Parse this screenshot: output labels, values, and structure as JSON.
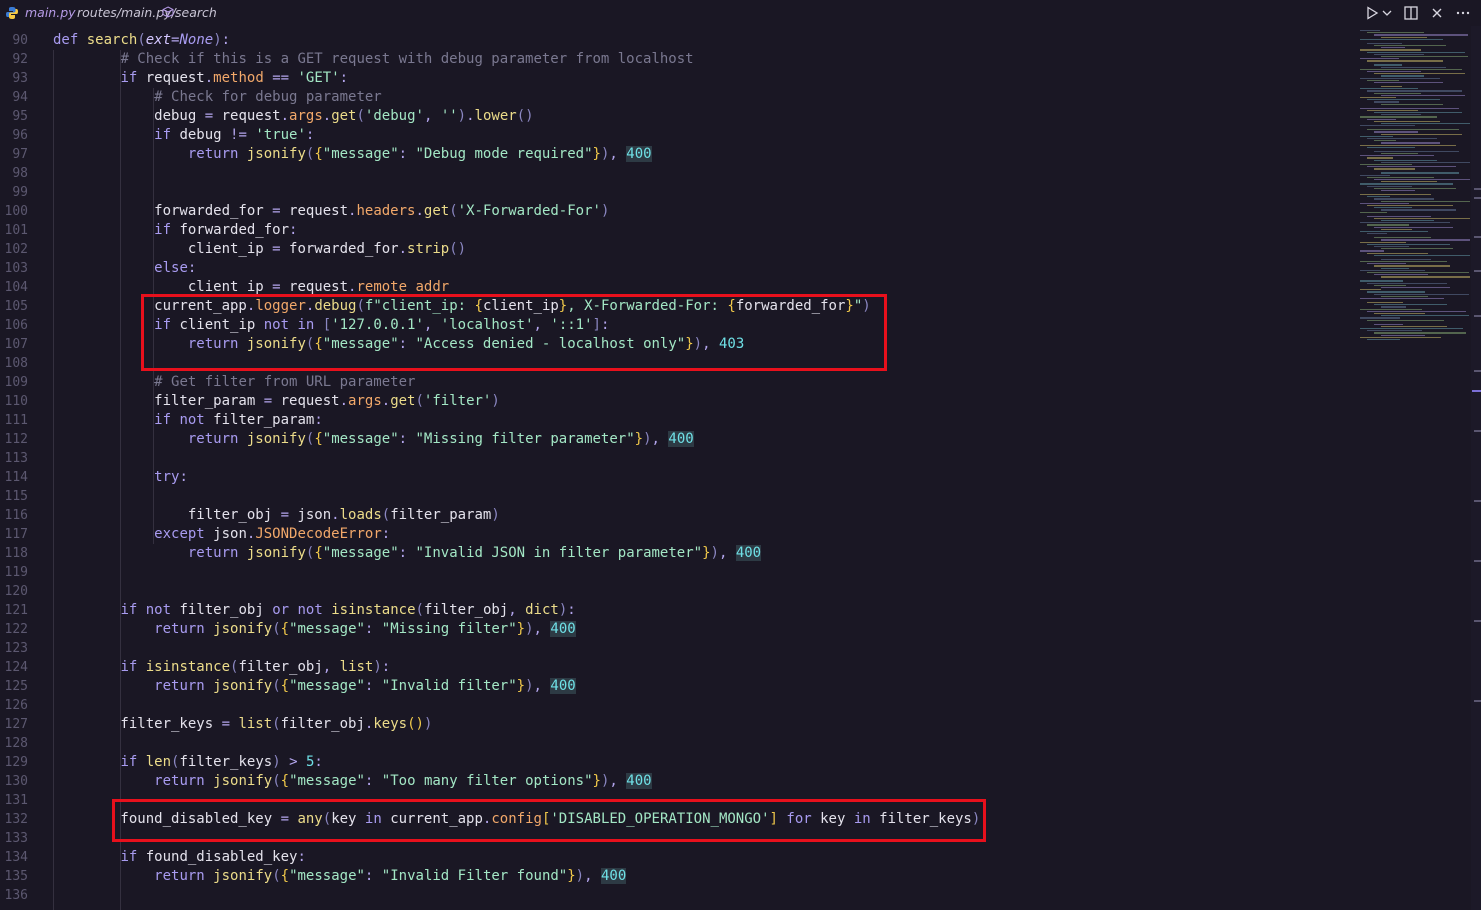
{
  "breadcrumb": {
    "file": "main.py",
    "path": "routes/main.py/",
    "symbol": "search",
    "icons": [
      "python-icon",
      "symbol-method-icon"
    ]
  },
  "toolbar": {
    "icons": [
      "run-icon",
      "dropdown-chevron-icon",
      "split-editor-icon",
      "close-icon",
      "more-actions-icon"
    ]
  },
  "editor": {
    "lines": [
      {
        "num": "90",
        "code": "def search(ext=None):"
      },
      {
        "num": "92",
        "code": "        # Check if this is a GET request with debug parameter from localhost"
      },
      {
        "num": "93",
        "code": "        if request.method == 'GET':"
      },
      {
        "num": "94",
        "code": "            # Check for debug parameter"
      },
      {
        "num": "95",
        "code": "            debug = request.args.get('debug', '').lower()"
      },
      {
        "num": "96",
        "code": "            if debug != 'true':"
      },
      {
        "num": "97",
        "code": "                return jsonify({\"message\": \"Debug mode required\"}), 400"
      },
      {
        "num": "98",
        "code": ""
      },
      {
        "num": "99",
        "code": ""
      },
      {
        "num": "100",
        "code": "            forwarded_for = request.headers.get('X-Forwarded-For')"
      },
      {
        "num": "101",
        "code": "            if forwarded_for:"
      },
      {
        "num": "102",
        "code": "                client_ip = forwarded_for.strip()"
      },
      {
        "num": "103",
        "code": "            else:"
      },
      {
        "num": "104",
        "code": "                client_ip = request.remote_addr"
      },
      {
        "num": "105",
        "code": "            current_app.logger.debug(f\"client_ip: {client_ip}, X-Forwarded-For: {forwarded_for}\")"
      },
      {
        "num": "106",
        "code": "            if client_ip not in ['127.0.0.1', 'localhost', '::1']:"
      },
      {
        "num": "107",
        "code": "                return jsonify({\"message\": \"Access denied - localhost only\"}), 403"
      },
      {
        "num": "108",
        "code": ""
      },
      {
        "num": "109",
        "code": "            # Get filter from URL parameter"
      },
      {
        "num": "110",
        "code": "            filter_param = request.args.get('filter')"
      },
      {
        "num": "111",
        "code": "            if not filter_param:"
      },
      {
        "num": "112",
        "code": "                return jsonify({\"message\": \"Missing filter parameter\"}), 400"
      },
      {
        "num": "113",
        "code": ""
      },
      {
        "num": "114",
        "code": "            try:"
      },
      {
        "num": "115",
        "code": ""
      },
      {
        "num": "116",
        "code": "                filter_obj = json.loads(filter_param)"
      },
      {
        "num": "117",
        "code": "            except json.JSONDecodeError:"
      },
      {
        "num": "118",
        "code": "                return jsonify({\"message\": \"Invalid JSON in filter parameter\"}), 400"
      },
      {
        "num": "119",
        "code": ""
      },
      {
        "num": "120",
        "code": ""
      },
      {
        "num": "121",
        "code": "        if not filter_obj or not isinstance(filter_obj, dict):"
      },
      {
        "num": "122",
        "code": "            return jsonify({\"message\": \"Missing filter\"}), 400"
      },
      {
        "num": "123",
        "code": ""
      },
      {
        "num": "124",
        "code": "        if isinstance(filter_obj, list):"
      },
      {
        "num": "125",
        "code": "            return jsonify({\"message\": \"Invalid filter\"}), 400"
      },
      {
        "num": "126",
        "code": ""
      },
      {
        "num": "127",
        "code": "        filter_keys = list(filter_obj.keys())"
      },
      {
        "num": "128",
        "code": ""
      },
      {
        "num": "129",
        "code": "        if len(filter_keys) > 5:"
      },
      {
        "num": "130",
        "code": "            return jsonify({\"message\": \"Too many filter options\"}), 400"
      },
      {
        "num": "131",
        "code": ""
      },
      {
        "num": "132",
        "code": "        found_disabled_key = any(key in current_app.config['DISABLED_OPERATION_MONGO'] for key in filter_keys)"
      },
      {
        "num": "133",
        "code": ""
      },
      {
        "num": "134",
        "code": "        if found_disabled_key:"
      },
      {
        "num": "135",
        "code": "            return jsonify({\"message\": \"Invalid Filter found\"}), 400"
      },
      {
        "num": "136",
        "code": ""
      }
    ]
  },
  "highlights": [
    "client-ip-check-block",
    "disabled-key-check-line"
  ],
  "colors": {
    "background": "#1a1724",
    "keyword": "#a89bf0",
    "function": "#ecdc8a",
    "string": "#a3e7c5",
    "comment": "#7a7890",
    "number": "#6fe0e6",
    "attribute": "#f2a86a",
    "highlight_box": "#e8101c"
  }
}
